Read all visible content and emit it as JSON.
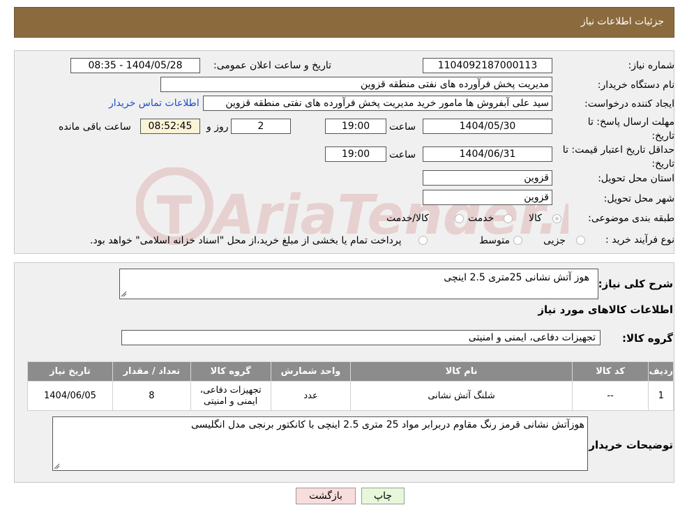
{
  "header": {
    "title": "جزئیات اطلاعات نیاز"
  },
  "form": {
    "need_number_label": "شماره نیاز:",
    "need_number": "1104092187000113",
    "announce_label": "تاریخ و ساعت اعلان عمومی:",
    "announce_value": "1404/05/28 - 08:35",
    "buyer_org_label": "نام دستگاه خریدار:",
    "buyer_org": "مدیریت پخش فرآورده های نفتی منطقه قزوین",
    "creator_label": "ایجاد کننده درخواست:",
    "creator": "سید علی  آبفروش ها مامور خرید مدیریت پخش فرآورده های نفتی منطقه قزوین",
    "contact_link": "اطلاعات تماس خریدار",
    "deadline_label": "مهلت ارسال پاسخ: تا تاریخ:",
    "deadline_date": "1404/05/30",
    "time_label": "ساعت",
    "deadline_time": "19:00",
    "days_value": "2",
    "days_label": "روز و",
    "remaining_time": "08:52:45",
    "remaining_label": "ساعت باقی مانده",
    "validity_label": "حداقل تاریخ اعتبار قیمت: تا تاریخ:",
    "validity_date": "1404/06/31",
    "validity_time": "19:00",
    "province_label": "استان محل تحویل:",
    "province": "قزوین",
    "city_label": "شهر محل تحویل:",
    "city": "قزوین",
    "category_label": "طبقه بندی موضوعی:",
    "category_options": [
      "کالا",
      "خدمت",
      "کالا/خدمت"
    ],
    "process_label": "نوع فرآیند خرید :",
    "process_options": [
      "جزیی",
      "متوسط"
    ],
    "process_note": "پرداخت تمام یا بخشی از مبلغ خرید،از محل \"اسناد خزانه اسلامی\" خواهد بود."
  },
  "details": {
    "description_label": "شرح کلی نیاز:",
    "description": "هوز آتش نشانی 25متری 2.5 اینچی",
    "goods_info_title": "اطلاعات کالاهای مورد نیاز",
    "goods_group_label": "گروه کالا:",
    "goods_group": "تجهیزات دفاعی، ایمنی و امنیتی",
    "table": {
      "headers": [
        "ردیف",
        "کد کالا",
        "نام کالا",
        "واحد شمارش",
        "گروه کالا",
        "تعداد / مقدار",
        "تاریخ نیاز"
      ],
      "rows": [
        [
          "1",
          "--",
          "شلنگ آتش نشانی",
          "عدد",
          "تجهیزات دفاعی، ایمنی و امنیتی",
          "8",
          "1404/06/05"
        ]
      ]
    },
    "buyer_notes_label": "توضیحات خریدار:",
    "buyer_notes": "هوزآتش نشانی قرمز رنگ مقاوم دربرابر مواد 25 متری 2.5 اینچی با کانکتور برنجی مدل انگلیسی"
  },
  "buttons": {
    "print": "چاپ",
    "back": "بازگشت"
  },
  "watermark": {
    "text": "AriaTender.neT"
  },
  "colors": {
    "header_bg": "#8b6a3e",
    "table_header_bg": "#8c8c8c",
    "link": "#1a4fc7",
    "print_btn": "#e6f8d9",
    "back_btn": "#f9dcdc"
  }
}
